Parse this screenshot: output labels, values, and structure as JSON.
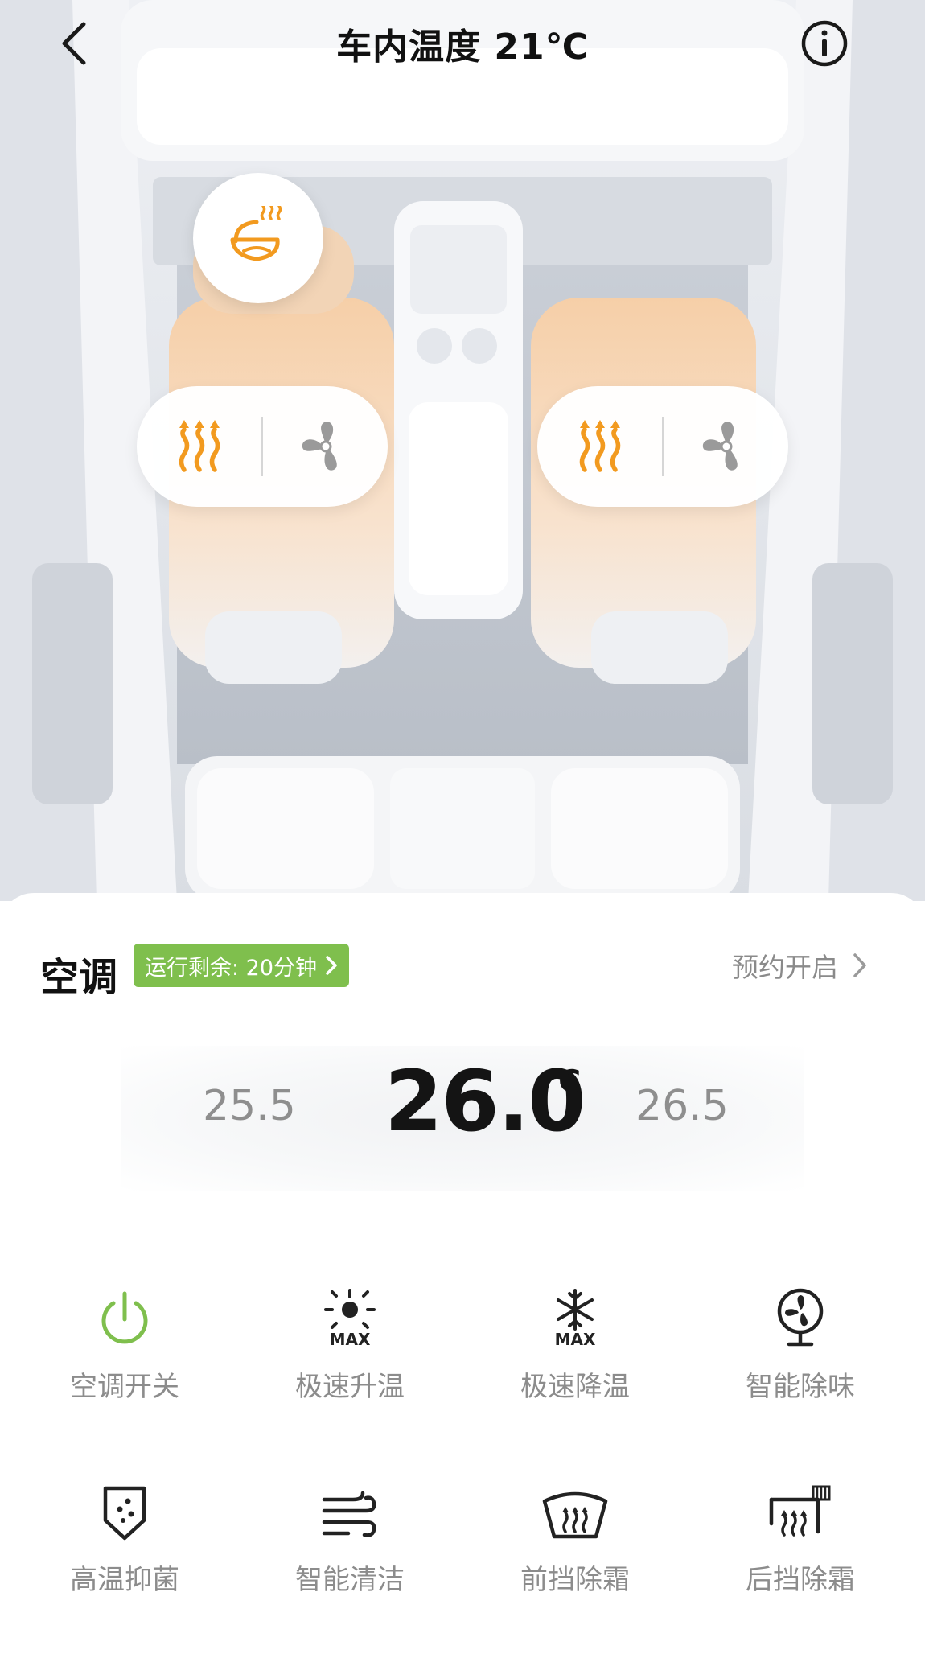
{
  "header": {
    "title": "车内温度 21℃"
  },
  "scene": {
    "seat_left": {
      "heat_icon": "seat-heat-icon",
      "vent_icon": "fan-icon"
    },
    "seat_right": {
      "heat_icon": "seat-heat-icon",
      "vent_icon": "fan-icon"
    },
    "steering_heat_icon": "steering-wheel-heat-icon",
    "colors": {
      "accent_orange": "#f29a1f",
      "icon_gray": "#9a9a9a"
    }
  },
  "ac": {
    "title": "空调",
    "remaining_badge": "运行剩余: 20分钟",
    "schedule_label": "预约开启",
    "temp_lower": "25.5",
    "temp_current": "26.0",
    "temp_unit": "℃",
    "temp_higher": "26.5",
    "badge_color": "#7fbf4d",
    "power_color": "#7fbf4d"
  },
  "functions": [
    {
      "label": "空调开关",
      "icon": "power-icon"
    },
    {
      "label": "极速升温",
      "icon": "max-heat-icon"
    },
    {
      "label": "极速降温",
      "icon": "max-cool-icon"
    },
    {
      "label": "智能除味",
      "icon": "deodorize-fan-icon"
    },
    {
      "label": "高温抑菌",
      "icon": "sterilize-icon"
    },
    {
      "label": "智能清洁",
      "icon": "airflow-clean-icon"
    },
    {
      "label": "前挡除霜",
      "icon": "front-defrost-icon"
    },
    {
      "label": "后挡除霜",
      "icon": "rear-defrost-icon"
    }
  ]
}
